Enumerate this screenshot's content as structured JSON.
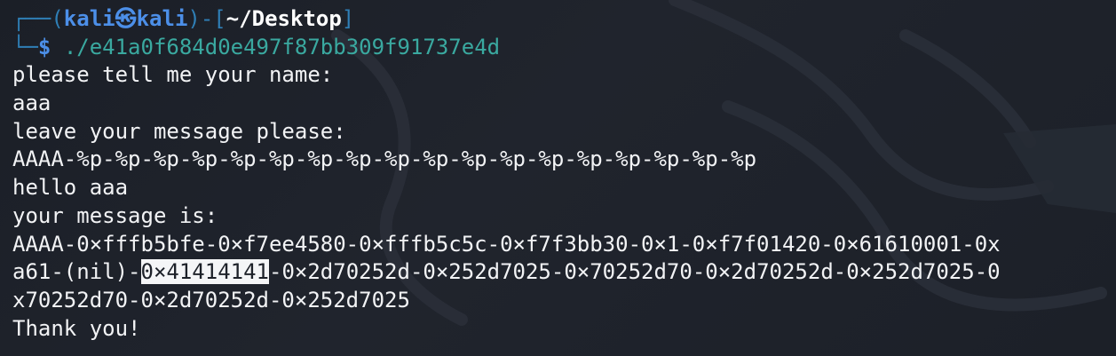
{
  "prompt": {
    "frame_open": "┌──(",
    "user": "kali",
    "symbol": "㉿",
    "host": "kali",
    "frame_mid": ")-[",
    "path": "~/Desktop",
    "frame_close": "]",
    "corner": "└─",
    "dollar": "$",
    "command": "./e41a0f684d0e497f87bb309f91737e4d"
  },
  "output": {
    "line1": "please tell me your name:",
    "line2": "aaa",
    "line3": "leave your message please:",
    "line4": "AAAA-%p-%p-%p-%p-%p-%p-%p-%p-%p-%p-%p-%p-%p-%p-%p-%p-%p-%p",
    "line5": "hello aaa",
    "line6": "your message is:",
    "line7": "AAAA-0×fffb5bfe-0×f7ee4580-0×fffb5c5c-0×f7f3bb30-0×1-0×f7f01420-0×61610001-0x",
    "line8_pre": "a61-(nil)-",
    "line8_highlight": "0×41414141",
    "line8_post": "-0×2d70252d-0×252d7025-0×70252d70-0×2d70252d-0×252d7025-0",
    "line9": "x70252d70-0×2d70252d-0×252d7025",
    "line10": "Thank you!"
  }
}
